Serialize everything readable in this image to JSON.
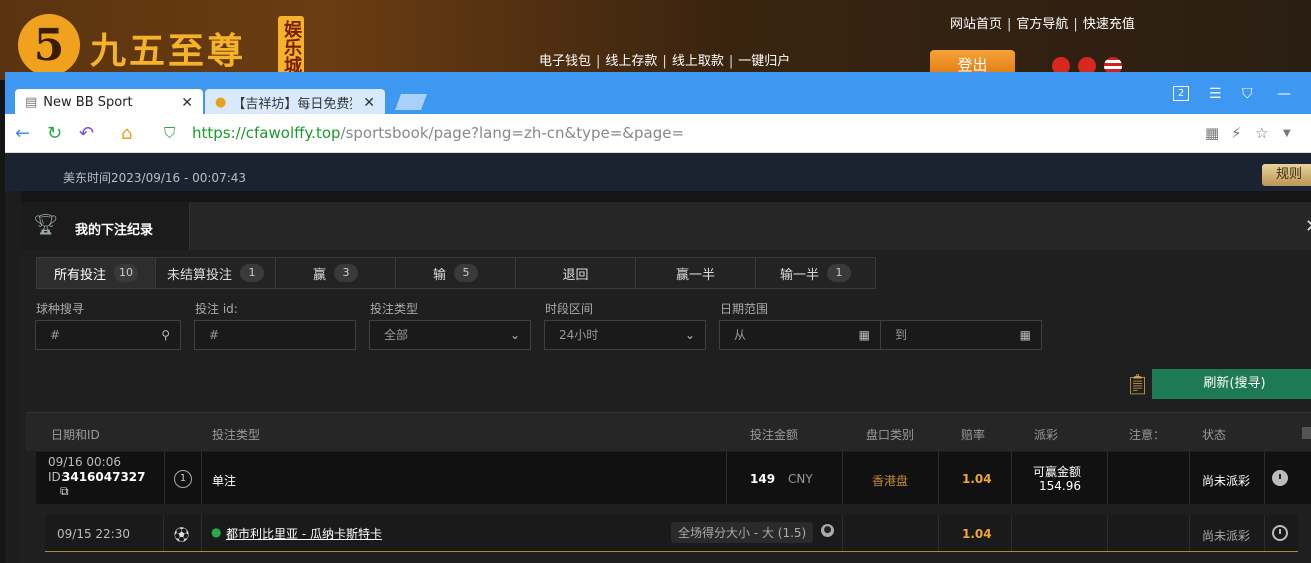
{
  "site": {
    "logo_digit": "5",
    "logo_name": "九五至尊",
    "logo_tag": "娱乐城",
    "top_links": [
      "网站首页",
      "官方导航",
      "快速充值"
    ],
    "mid_links": [
      "电子钱包",
      "线上存款",
      "线上取款",
      "一键归户"
    ],
    "logout": "登出"
  },
  "browser": {
    "tabs": [
      {
        "title": "New BB Sport",
        "active": true
      },
      {
        "title": "【吉祥坊】每日免费猜",
        "active": false
      }
    ],
    "tab_counter": "2",
    "url_proto": "https://",
    "url_host": "cfawolffy.top",
    "url_path": "/sportsbook/page?lang=zh-cn&type=&page="
  },
  "page": {
    "time_label": "美东时间2023/09/16 - 00:07:43",
    "rules_btn": "规则"
  },
  "panel": {
    "title": "我的下注纪录",
    "filter_tabs": [
      {
        "label": "所有投注",
        "count": "10"
      },
      {
        "label": "未结算投注",
        "count": "1"
      },
      {
        "label": "赢",
        "count": "3"
      },
      {
        "label": "输",
        "count": "5"
      },
      {
        "label": "退回",
        "count": ""
      },
      {
        "label": "赢一半",
        "count": ""
      },
      {
        "label": "输一半",
        "count": "1"
      }
    ],
    "fields": {
      "sport_label": "球种搜寻",
      "sport_placeholder": "#",
      "betid_label": "投注 id:",
      "betid_placeholder": "#",
      "bettype_label": "投注类型",
      "bettype_value": "全部",
      "period_label": "时段区间",
      "period_value": "24小时",
      "date_label": "日期范围",
      "date_from": "从",
      "date_to": "到"
    },
    "refresh": "刷新(搜寻)"
  },
  "table": {
    "headers": [
      "日期和ID",
      "投注类型",
      "投注金额",
      "盘口类别",
      "赔率",
      "派彩",
      "注意：",
      "状态"
    ],
    "bet": {
      "date": "09/16 00:06",
      "id_prefix": "ID:",
      "id": "3416047327",
      "type": "单注",
      "amount": "149",
      "currency": "CNY",
      "market_class": "香港盘",
      "odds": "1.04",
      "payout_label": "可赢金额",
      "payout_value": "154.96",
      "status": "尚未派彩"
    },
    "leg": {
      "date": "09/15 22:30",
      "match": "都市利比里亚 - 瓜纳卡斯特卡",
      "market": "全场得分大小 - 大 (1.5)",
      "odds": "1.04",
      "status": "尚未派彩"
    }
  }
}
